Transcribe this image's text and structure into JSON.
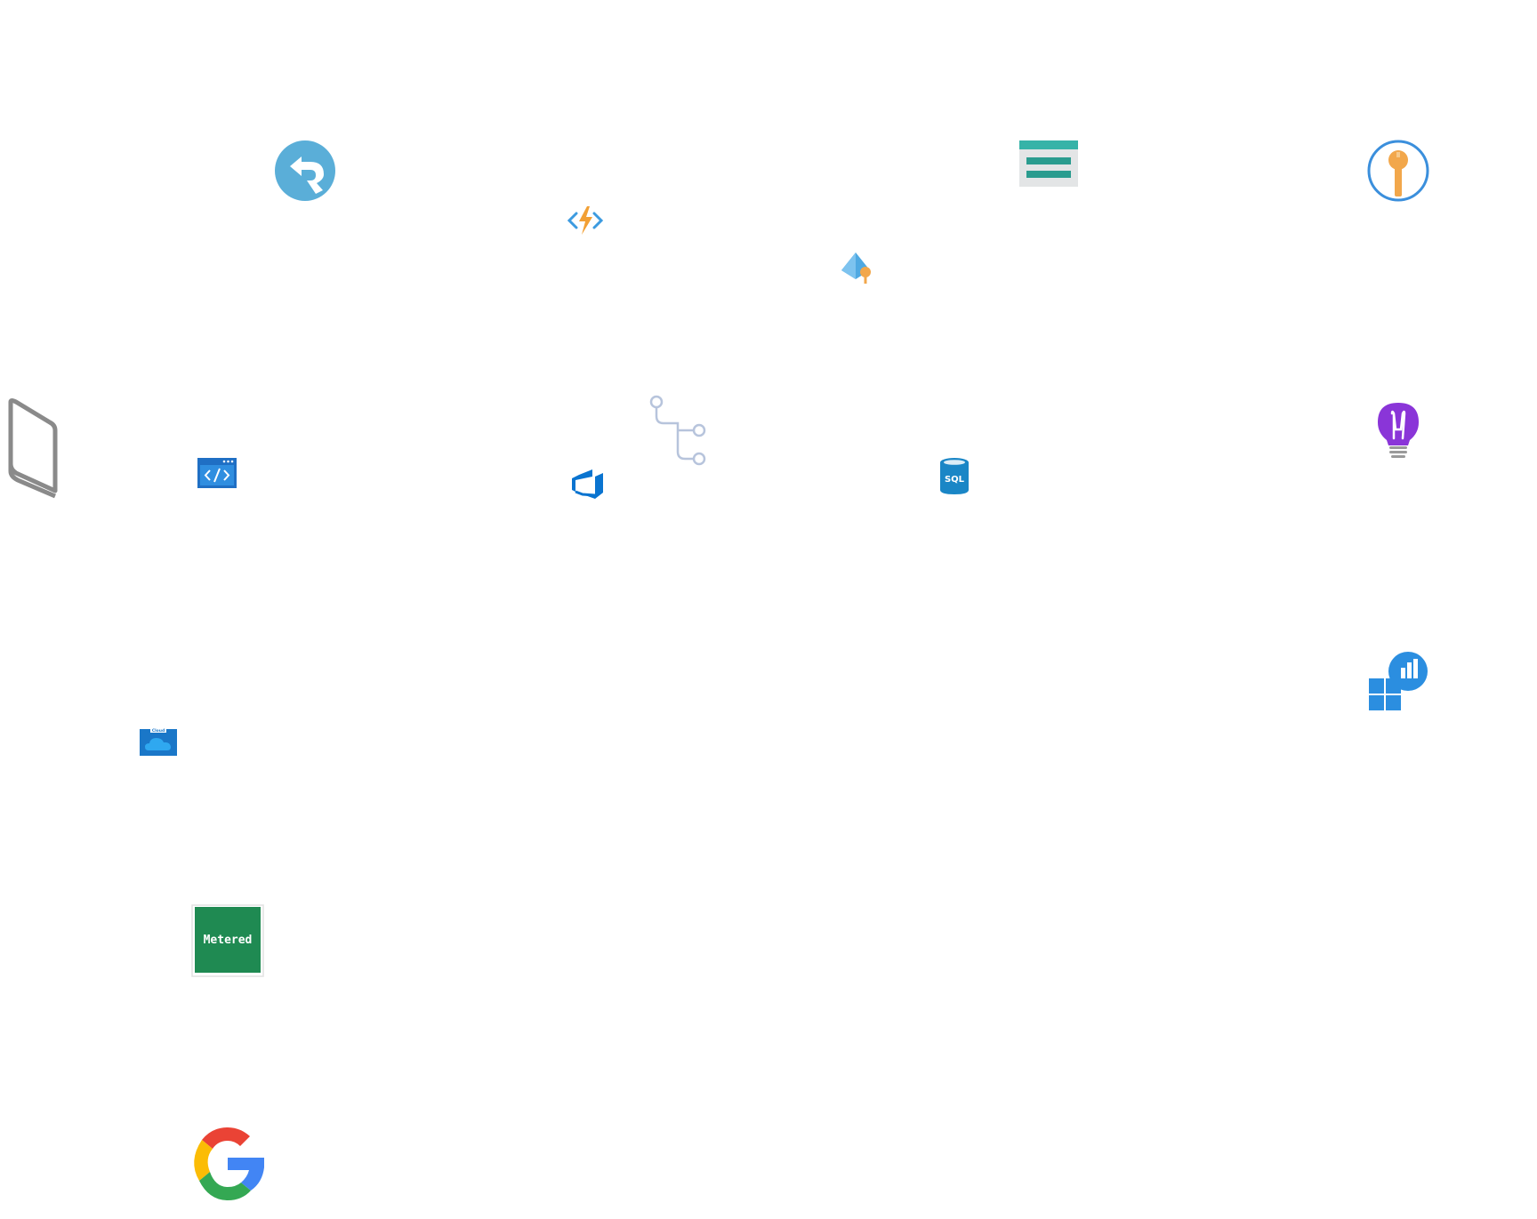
{
  "canvas": {
    "background": "#ffffff"
  },
  "icons": [
    {
      "id": "remote-desktop",
      "name": "remote-desktop-icon",
      "color": "#5aaed8"
    },
    {
      "id": "azure-functions",
      "name": "azure-functions-icon",
      "colors": {
        "bolt": "#f2a035",
        "brackets": "#3c9be0"
      }
    },
    {
      "id": "azure-ad-key",
      "name": "azure-ad-key-icon",
      "colors": {
        "pyramid": "#4fa9e2",
        "key": "#f2a74b"
      }
    },
    {
      "id": "layers",
      "name": "stacked-layers-icon",
      "colors": {
        "top": "#36b3a8",
        "middle": "#2a9c8f",
        "base": "#d8dadb"
      }
    },
    {
      "id": "key-circle",
      "name": "key-in-circle-icon",
      "colors": {
        "ring": "#3b8fdc",
        "key": "#f2a74b"
      }
    },
    {
      "id": "bookmark",
      "name": "bookmark-icon",
      "color": "#8a8a8a"
    },
    {
      "id": "code-window",
      "name": "code-window-icon",
      "color": "#1f6fc4"
    },
    {
      "id": "azure-devops",
      "name": "azure-devops-icon",
      "color": "#0a74d0"
    },
    {
      "id": "git-tree",
      "name": "git-branch-tree-icon",
      "color": "#b7c4dc"
    },
    {
      "id": "sql-database",
      "name": "sql-database-icon",
      "color": "#1a86c6",
      "label": "SQL"
    },
    {
      "id": "lightbulb",
      "name": "lightbulb-icon",
      "colors": {
        "bulb": "#8a35d8",
        "base": "#9a9a9a"
      }
    },
    {
      "id": "start-analytics",
      "name": "windows-start-analytics-icon",
      "color": "#2b8ee0"
    },
    {
      "id": "cloud-box",
      "name": "cloud-storage-icon",
      "color": "#1a77c8",
      "label": "Cloud"
    },
    {
      "id": "metered",
      "name": "metered-badge-icon",
      "color": "#1f8a52",
      "label": "Metered"
    },
    {
      "id": "google",
      "name": "google-g-icon",
      "colors": {
        "red": "#ea4335",
        "yellow": "#fbbc05",
        "green": "#34a853",
        "blue": "#4285f4"
      }
    }
  ]
}
